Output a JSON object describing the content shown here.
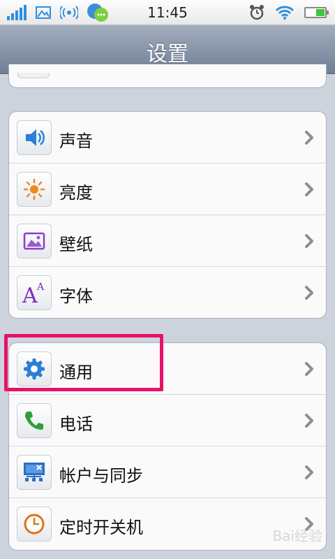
{
  "status_bar": {
    "time": "11:45",
    "icons": [
      "signal-icon",
      "image-icon",
      "wifi-hotspot-icon",
      "chat-app-icon",
      "alarm-icon",
      "wifi-icon",
      "battery-icon"
    ]
  },
  "header": {
    "title": "设置"
  },
  "group_1": [
    {
      "label": "声音",
      "icon": "speaker-icon"
    },
    {
      "label": "亮度",
      "icon": "sun-icon"
    },
    {
      "label": "壁纸",
      "icon": "picture-icon"
    },
    {
      "label": "字体",
      "icon": "font-icon"
    }
  ],
  "group_2": [
    {
      "label": "通用",
      "icon": "gear-icon"
    },
    {
      "label": "电话",
      "icon": "phone-icon"
    },
    {
      "label": "帐户与同步",
      "icon": "sync-icon"
    },
    {
      "label": "定时开关机",
      "icon": "clock-icon"
    }
  ],
  "colors": {
    "highlight": "#e8116a",
    "header_bg": "#8391a6",
    "accent_blue": "#2e8fe0"
  },
  "watermark": "Bai经验"
}
